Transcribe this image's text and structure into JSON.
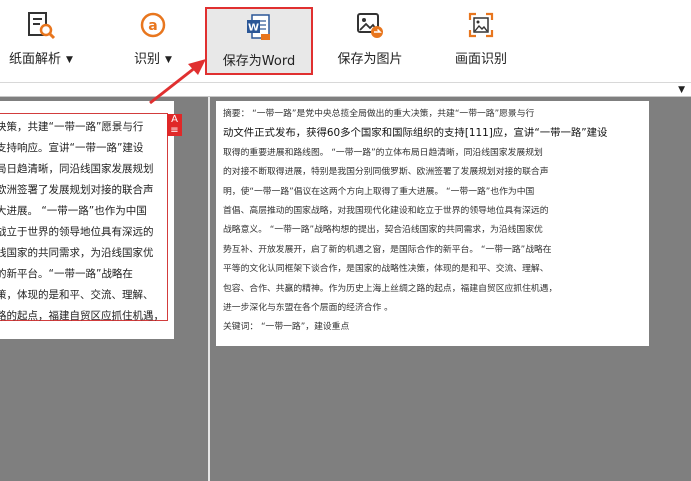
{
  "toolbar": {
    "items": [
      {
        "label": "纸面解析",
        "has_dropdown": true,
        "icon": "document-magnify-icon"
      },
      {
        "label": "识别",
        "has_dropdown": true,
        "icon": "ocr-a-icon"
      },
      {
        "label": "保存为Word",
        "has_dropdown": false,
        "icon": "word-icon",
        "selected": true
      },
      {
        "label": "保存为图片",
        "has_dropdown": false,
        "icon": "image-export-icon"
      },
      {
        "label": "画面识别",
        "has_dropdown": false,
        "icon": "screen-capture-icon"
      }
    ],
    "dropdown_glyph": "▼"
  },
  "left_page": {
    "lines": [
      "决策，共建“一带一路”愿景与行",
      "支持响应。宣讲“一带一路”建设",
      "局日趋清晰，同沿线国家发展规划",
      "欧洲签署了发展规划对接的联合声",
      "大进展。  “一带一路”也作为中国",
      "战立于世界的领导地位具有深远的",
      "线国家的共同需求，为沿线国家优",
      "的新平台。“一带一路”战略在",
      "策，体现的是和平、交流、理解、",
      "路的起点，福建自贸区应抓住机遇，"
    ],
    "annotation_icon": "A"
  },
  "right_page": {
    "lines": [
      "摘要：  “一带一路”是党中央总揽全局做出的重大决策，共建“一带一路”愿景与行",
      "动文件正式发布，获得60多个国家和国际组织的支持[111]应，宣讲“一带一路”建设",
      "取得的重要进展和路线图。  “一带一路”的立体布局日趋清晰，同沿线国家发展规划",
      "的对接不断取得进展，特别是我国分别同俄罗斯、欧洲签署了发展规划对接的联合声",
      "明，使“一带一路”倡议在这两个方向上取得了重大进展。  “一带一路”也作为中国",
      "首倡、高层推动的国家战略，对我国现代化建设和屹立于世界的领导地位具有深远的",
      "战略意义。  “一带一路”战略构想的提出，契合沿线国家的共同需求，为沿线国家优",
      "势互补、开放发展开，启了新的机遇之窗，是国际合作的新平台。  “一带一路”战略在",
      "平等的文化认同框架下谈合作，是国家的战略性决策，体现的是和平、交流、理解、",
      "包容、合作、共赢的精神。作为历史上海上丝绸之路的起点，福建自贸区应抓住机遇，",
      "进一步深化与东盟在各个层面的经济合作  。",
      "关键词：  “一带一路”，建设重点"
    ]
  },
  "colors": {
    "highlight": "#e03030",
    "workspace": "#7f7f7f"
  }
}
